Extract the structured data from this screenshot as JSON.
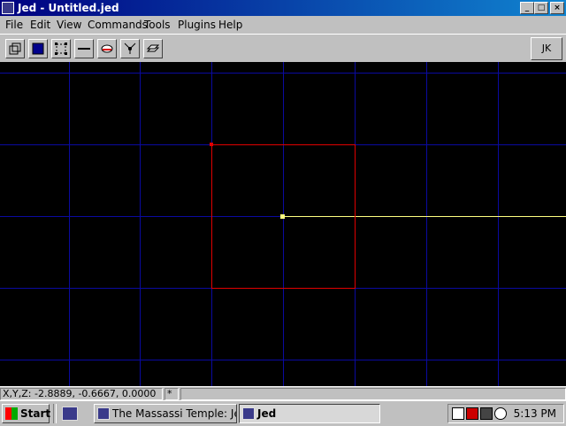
{
  "window": {
    "title": "Jed - Untitled.jed"
  },
  "menu": [
    "File",
    "Edit",
    "View",
    "Commands",
    "Tools",
    "Plugins",
    "Help"
  ],
  "toolbar": {
    "jk_label": "JK"
  },
  "status": {
    "coords": "X,Y,Z: -2.8889, -0.6667, 0.0000",
    "mode": "*"
  },
  "taskbar": {
    "start_label": "Start",
    "tasks": [
      "The Massassi Temple: Jed...",
      "Jed"
    ],
    "clock": "5:13 PM"
  },
  "colors": {
    "grid": "#0a0aa0",
    "selection": "#e00000",
    "axis": "#ffff80"
  }
}
